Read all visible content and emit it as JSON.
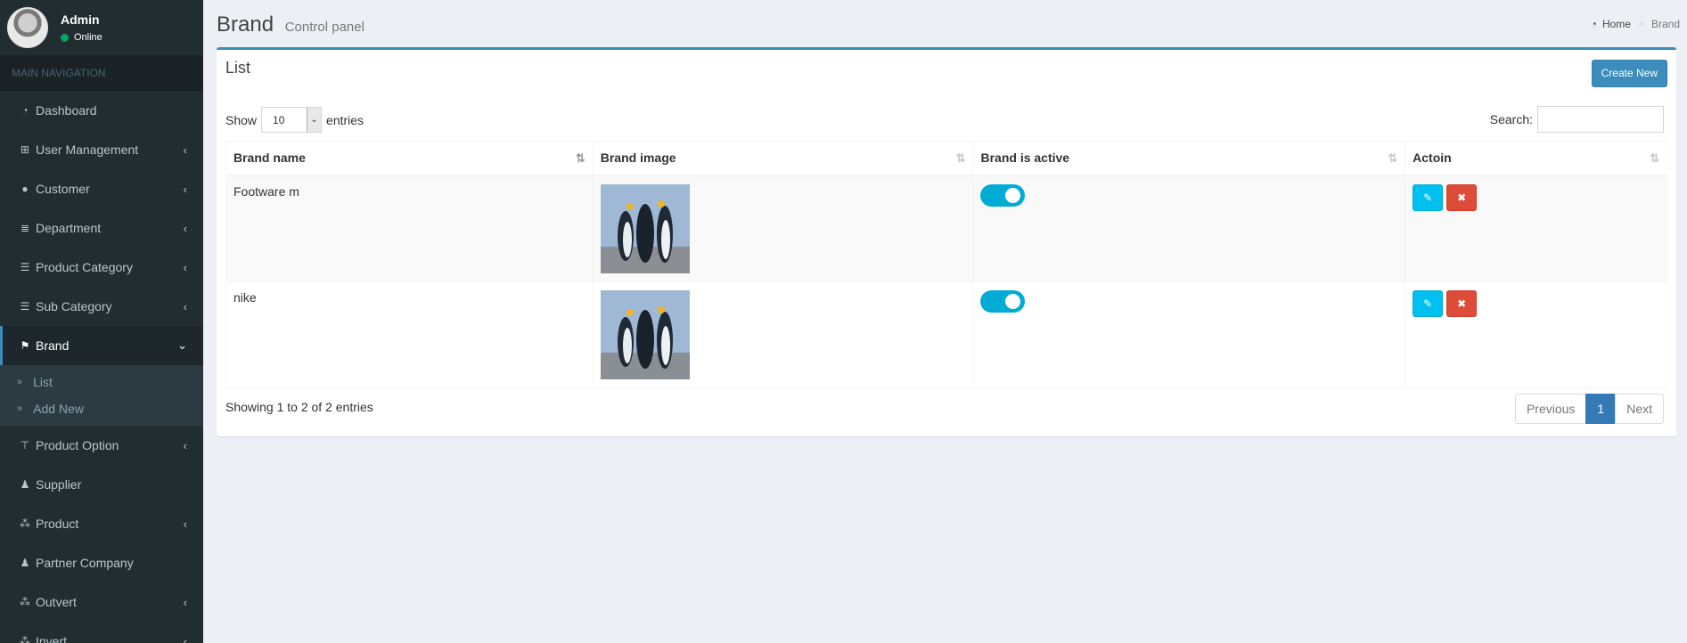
{
  "user": {
    "name": "Admin",
    "status": "Online"
  },
  "nav": {
    "header": "MAIN NAVIGATION",
    "items": [
      {
        "label": "Dashboard",
        "icon": "dashboard-icon",
        "glyph": "◔",
        "chevron": ""
      },
      {
        "label": "User Management",
        "icon": "sitemap-icon",
        "glyph": "⊞",
        "chevron": "‹"
      },
      {
        "label": "Customer",
        "icon": "user-icon",
        "glyph": "●",
        "chevron": "‹"
      },
      {
        "label": "Department",
        "icon": "database-icon",
        "glyph": "≣",
        "chevron": "‹"
      },
      {
        "label": "Product Category",
        "icon": "list-icon",
        "glyph": "☰",
        "chevron": "‹"
      },
      {
        "label": "Sub Category",
        "icon": "list-icon",
        "glyph": "☰",
        "chevron": "‹"
      },
      {
        "label": "Brand",
        "icon": "flag-icon",
        "glyph": "⚑",
        "chevron": "⌄"
      },
      {
        "label": "Product Option",
        "icon": "signpost-icon",
        "glyph": "⊤",
        "chevron": "‹"
      },
      {
        "label": "Supplier",
        "icon": "users-icon",
        "glyph": "♟",
        "chevron": ""
      },
      {
        "label": "Product",
        "icon": "cubes-icon",
        "glyph": "⁂",
        "chevron": "‹"
      },
      {
        "label": "Partner Company",
        "icon": "users-icon",
        "glyph": "♟",
        "chevron": ""
      },
      {
        "label": "Outvert",
        "icon": "cubes-icon",
        "glyph": "⁂",
        "chevron": "‹"
      },
      {
        "label": "Invert",
        "icon": "cubes-icon",
        "glyph": "⁂",
        "chevron": "‹"
      }
    ],
    "brand_sub": [
      {
        "label": "List"
      },
      {
        "label": "Add New"
      }
    ]
  },
  "header": {
    "title": "Brand",
    "subtitle": "Control panel"
  },
  "breadcrumb": {
    "home": "Home",
    "current": "Brand",
    "separator": ">"
  },
  "box": {
    "title": "List",
    "create_label": "Create New",
    "show_label": "Show",
    "entries_value": "10",
    "entries_label": "entries",
    "search_label": "Search:",
    "search_value": ""
  },
  "table": {
    "columns": [
      "Brand name",
      "Brand image",
      "Brand is active",
      "Actoin"
    ],
    "rows": [
      {
        "name": "Footware m",
        "active": true
      },
      {
        "name": "nike",
        "active": true
      }
    ]
  },
  "footer": {
    "info": "Showing 1 to 2 of 2 entries",
    "prev": "Previous",
    "page": "1",
    "next": "Next"
  },
  "colors": {
    "accent": "#3c8dbc",
    "toggle": "#00acd6",
    "edit": "#00c0ef",
    "delete": "#dd4b39",
    "sidebar": "#222d32"
  }
}
